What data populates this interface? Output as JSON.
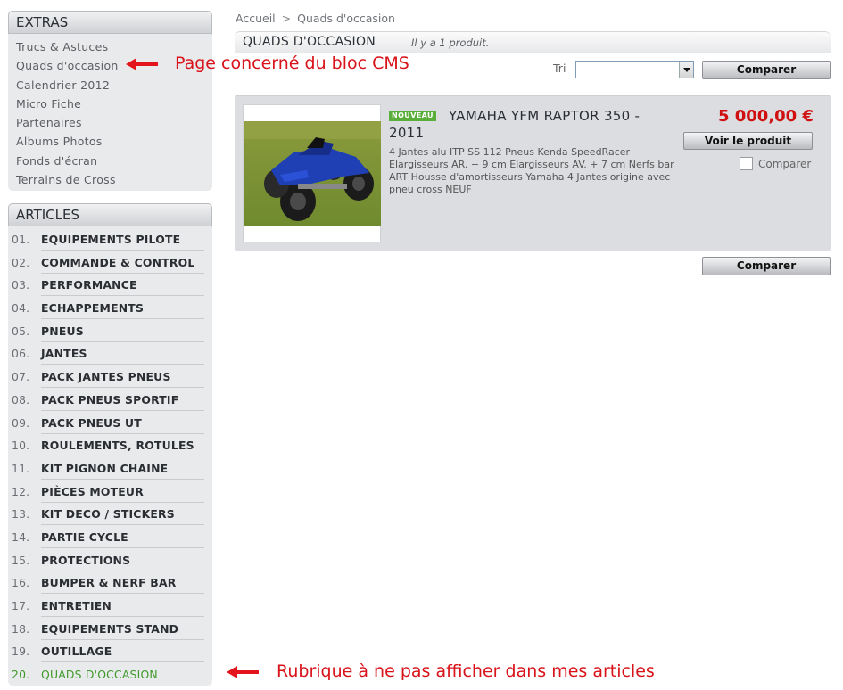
{
  "extras": {
    "title": "EXTRAS",
    "items": [
      "Trucs & Astuces",
      "Quads d'occasion",
      "Calendrier 2012",
      "Micro Fiche",
      "Partenaires",
      "Albums Photos",
      "Fonds d'écran",
      "Terrains de Cross"
    ]
  },
  "articles": {
    "title": "ARTICLES",
    "items": [
      {
        "num": "01.",
        "label": "EQUIPEMENTS PILOTE"
      },
      {
        "num": "02.",
        "label": "COMMANDE & CONTROL"
      },
      {
        "num": "03.",
        "label": "PERFORMANCE"
      },
      {
        "num": "04.",
        "label": "ECHAPPEMENTS"
      },
      {
        "num": "05.",
        "label": "PNEUS"
      },
      {
        "num": "06.",
        "label": "JANTES"
      },
      {
        "num": "07.",
        "label": "PACK JANTES PNEUS"
      },
      {
        "num": "08.",
        "label": "PACK PNEUS SPORTIF"
      },
      {
        "num": "09.",
        "label": "PACK PNEUS UT"
      },
      {
        "num": "10.",
        "label": "ROULEMENTS, ROTULES"
      },
      {
        "num": "11.",
        "label": "KIT PIGNON CHAINE"
      },
      {
        "num": "12.",
        "label": "PIÈCES MOTEUR"
      },
      {
        "num": "13.",
        "label": "KIT DECO / STICKERS"
      },
      {
        "num": "14.",
        "label": "PARTIE CYCLE"
      },
      {
        "num": "15.",
        "label": "PROTECTIONS"
      },
      {
        "num": "16.",
        "label": "BUMPER & NERF BAR"
      },
      {
        "num": "17.",
        "label": "ENTRETIEN"
      },
      {
        "num": "18.",
        "label": "EQUIPEMENTS STAND"
      },
      {
        "num": "19.",
        "label": "OUTILLAGE"
      },
      {
        "num": "20.",
        "label": "QUADS D'OCCASION"
      }
    ]
  },
  "annotations": {
    "cms": "Page concerné du bloc CMS",
    "rubrique": "Rubrique à ne pas afficher dans mes articles"
  },
  "breadcrumb": {
    "home": "Accueil",
    "sep": ">",
    "current": "Quads d'occasion"
  },
  "category": {
    "title": "QUADS D'OCCASION",
    "count": "Il y a 1 produit."
  },
  "sort": {
    "label": "Tri",
    "selected": "--"
  },
  "compare_label": "Comparer",
  "product": {
    "badge": "NOUVEAU",
    "name": "YAMAHA YFM RAPTOR 350 - 2011",
    "description": "4 Jantes alu ITP SS 112 Pneus Kenda SpeedRacer Elargisseurs AR. + 9 cm Elargisseurs AV. + 7 cm Nerfs bar ART Housse d'amortisseurs Yamaha 4 Jantes origine avec pneu cross NEUF",
    "price": "5 000,00 €",
    "view_label": "Voir le produit",
    "compare_checkbox_label": "Comparer"
  },
  "colors": {
    "accent_green": "#3f9a2b",
    "price_red": "#d01010",
    "annotation_red": "#d9131a",
    "badge_green": "#5aae3a"
  }
}
